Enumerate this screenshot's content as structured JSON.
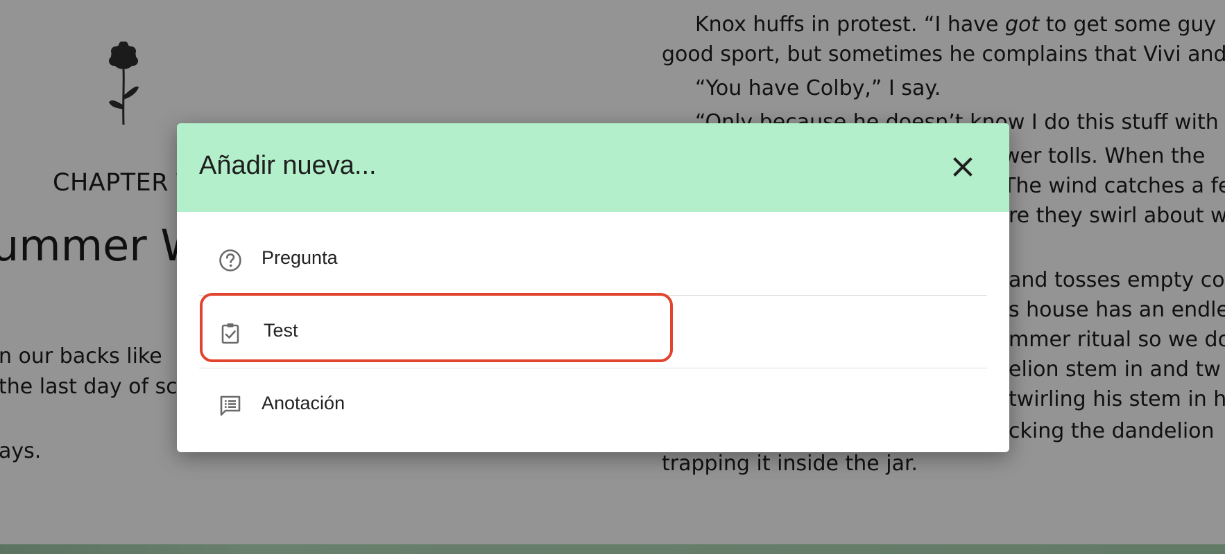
{
  "book": {
    "left_page": {
      "chapter_label": "CHAPTER T",
      "chapter_title": "ummer W",
      "lines": [
        "n our backs like",
        " the last day of sc",
        "ays."
      ]
    },
    "right_page": {
      "line1_before": "Knox huffs in protest. “I have ",
      "line1_italic": "got",
      "line1_after": " to get some guy",
      "lines": [
        "good sport, but sometimes he complains that Vivi and",
        "“You have Colby,” I say.",
        "“Only because he doesn’t know I do this stuff with y",
        "wer tolls. When the",
        "The wind catches a fe",
        "re they swirl about w",
        "and tosses empty con",
        "s house has an endle",
        "mmer ritual so we do",
        "elion stem in and tw",
        " twirling his stem in h",
        "cking the dandelion",
        "trapping it inside the jar."
      ]
    }
  },
  "dialog": {
    "title": "Añadir nueva...",
    "header_color": "#b4efcc",
    "close_icon": "close-icon",
    "options": [
      {
        "label": "Pregunta",
        "icon": "help-circle-icon"
      },
      {
        "label": "Test",
        "icon": "clipboard-check-icon",
        "highlighted": true
      },
      {
        "label": "Anotación",
        "icon": "comment-list-icon"
      }
    ]
  },
  "highlight_color": "#e2432c"
}
